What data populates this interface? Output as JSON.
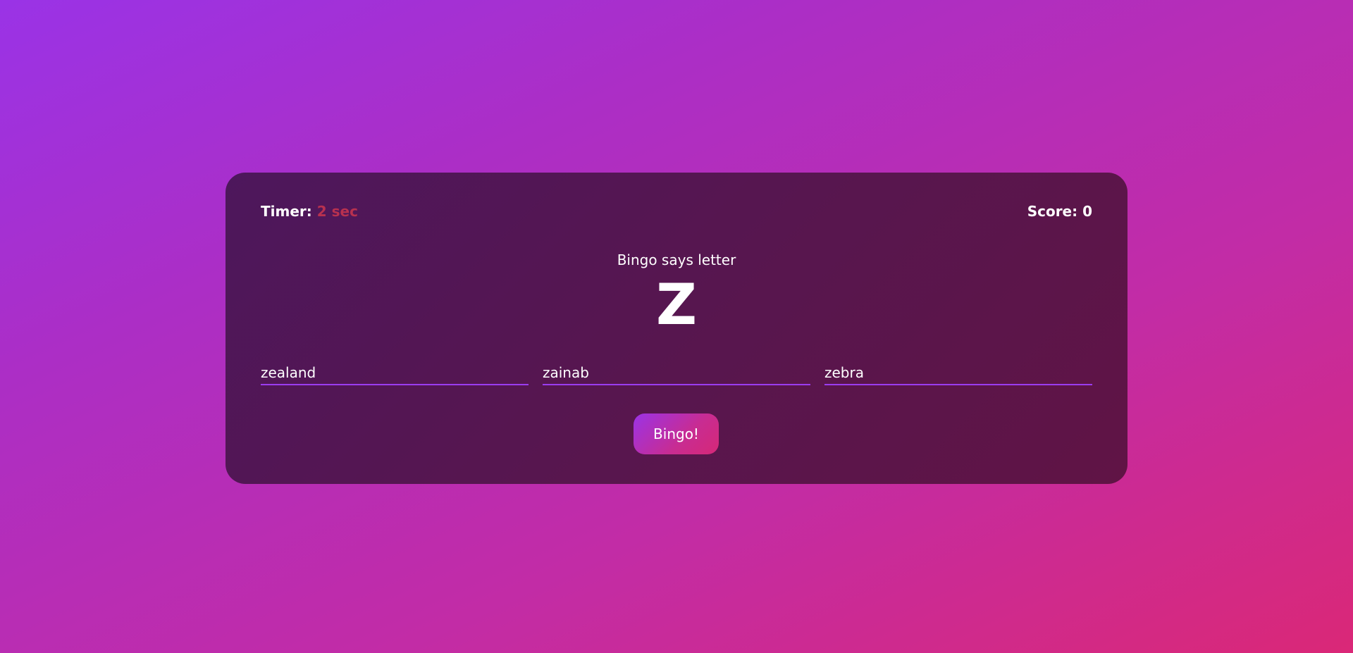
{
  "header": {
    "timer_label": "Timer:",
    "timer_value": "2 sec",
    "score_label": "Score: 0"
  },
  "prompt": {
    "text": "Bingo says letter",
    "letter": "Z"
  },
  "answers": [
    {
      "value": "zealand"
    },
    {
      "value": "zainab"
    },
    {
      "value": "zebra"
    }
  ],
  "actions": {
    "bingo_label": "Bingo!"
  },
  "colors": {
    "timer_value": "#b8314f",
    "input_underline": "#9b3cf0",
    "card_bg": "#55165a"
  }
}
